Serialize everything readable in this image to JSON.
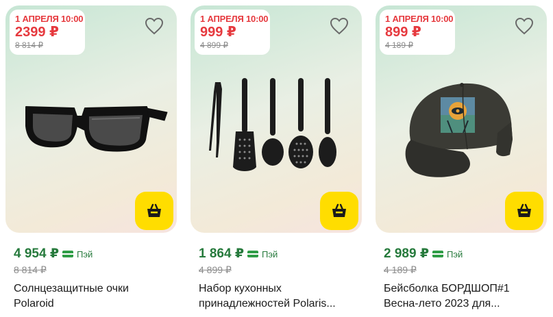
{
  "products": [
    {
      "promo_date": "1 АПРЕЛЯ 10:00",
      "promo_price": "2399 ₽",
      "promo_old_price": "8 814 ₽",
      "price": "4 954 ₽",
      "pay_label": "Пэй",
      "old_price": "8 814 ₽",
      "title_line1": "Солнцезащитные очки",
      "title_line2": "Polaroid",
      "image": "sunglasses"
    },
    {
      "promo_date": "1 АПРЕЛЯ 10:00",
      "promo_price": "999 ₽",
      "promo_old_price": "4 899 ₽",
      "price": "1 864 ₽",
      "pay_label": "Пэй",
      "old_price": "4 899 ₽",
      "title_line1": "Набор кухонных",
      "title_line2": "принадлежностей Polaris...",
      "image": "kitchen-utensils"
    },
    {
      "promo_date": "1 АПРЕЛЯ 10:00",
      "promo_price": "899 ₽",
      "promo_old_price": "4 189 ₽",
      "price": "2 989 ₽",
      "pay_label": "Пэй",
      "old_price": "4 189 ₽",
      "title_line1": "Бейсболка БОРДШОП#1",
      "title_line2": "Весна-лето 2023 для...",
      "image": "baseball-cap"
    }
  ],
  "icons": {
    "favorite": "heart-outline-icon",
    "cart": "basket-icon",
    "payment": "card-icon"
  },
  "colors": {
    "promo_red": "#e6393e",
    "price_green": "#267a3c",
    "cart_yellow": "#ffdd00",
    "old_price_gray": "#8c8c8c"
  }
}
